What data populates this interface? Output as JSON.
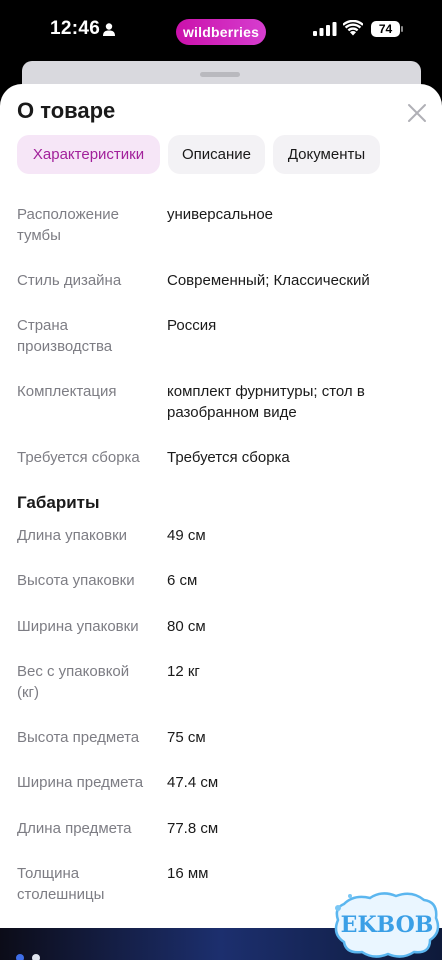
{
  "status_bar": {
    "time": "12:46",
    "app_badge": "wildberries",
    "battery": "74"
  },
  "sheet": {
    "title": "О товаре",
    "tabs": [
      {
        "label": "Характеристики",
        "active": true
      },
      {
        "label": "Описание",
        "active": false
      },
      {
        "label": "Документы",
        "active": false
      }
    ]
  },
  "characteristics": [
    {
      "label": "Расположение тумбы",
      "value": "универсальное"
    },
    {
      "label": "Стиль дизайна",
      "value": "Современный; Классический"
    },
    {
      "label": "Страна производства",
      "value": "Россия"
    },
    {
      "label": "Комплектация",
      "value": "комплект фурнитуры; стол в разобранном виде"
    },
    {
      "label": "Требуется сборка",
      "value": "Требуется сборка"
    }
  ],
  "dimensions": {
    "heading": "Габариты",
    "items": [
      {
        "label": "Длина упаковки",
        "value": "49 см"
      },
      {
        "label": "Высота упаковки",
        "value": "6 см"
      },
      {
        "label": "Ширина упаковки",
        "value": "80 см"
      },
      {
        "label": "Вес с упаковкой (кг)",
        "value": "12 кг"
      },
      {
        "label": "Высота предмета",
        "value": "75 см"
      },
      {
        "label": "Ширина предмета",
        "value": "47.4 см"
      },
      {
        "label": "Длина предмета",
        "value": "77.8 см"
      },
      {
        "label": "Толщина столешницы",
        "value": "16 мм"
      }
    ]
  },
  "watermark": {
    "text": "EKBOB"
  },
  "colors": {
    "accent": "#a2219b",
    "active_tab_bg": "#f6e6f7",
    "label_gray": "#7d7d84",
    "brand_pill": "#cb11ab"
  }
}
